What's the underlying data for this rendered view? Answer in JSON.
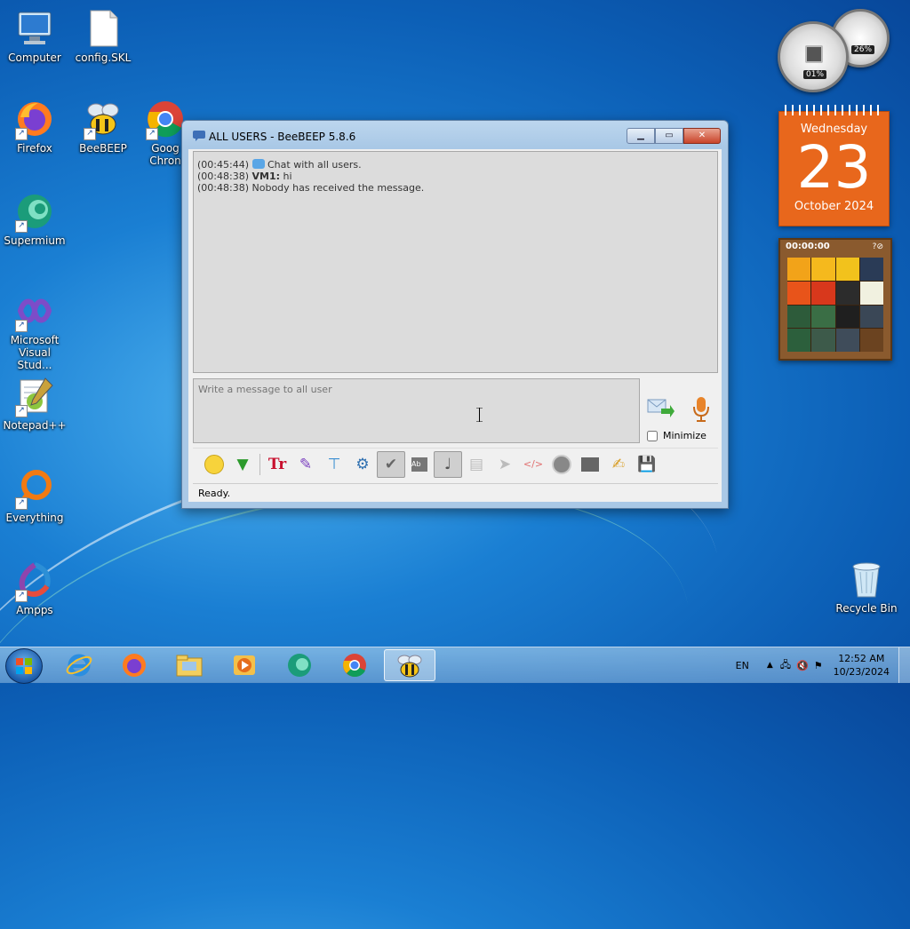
{
  "desktop": {
    "icons": [
      {
        "label": "Computer",
        "icon": "computer-icon"
      },
      {
        "label": "config.SKL",
        "icon": "file-icon"
      },
      {
        "label": "Firefox",
        "icon": "firefox-icon"
      },
      {
        "label": "BeeBEEP",
        "icon": "bee-icon"
      },
      {
        "label": "Goog Chron",
        "icon": "chrome-icon"
      },
      {
        "label": "Supermium",
        "icon": "supermium-icon"
      },
      {
        "label": "Microsoft Visual Stud...",
        "icon": "visual-studio-icon"
      },
      {
        "label": "Notepad++",
        "icon": "notepadpp-icon"
      },
      {
        "label": "Everything",
        "icon": "everything-icon"
      },
      {
        "label": "Ampps",
        "icon": "ampps-icon"
      },
      {
        "label": "Recycle Bin",
        "icon": "recycle-bin-icon"
      }
    ]
  },
  "gadgets": {
    "cpu": {
      "cpu_percent": "01%",
      "mem_percent": "26%"
    },
    "calendar": {
      "weekday": "Wednesday",
      "day": "23",
      "month_year": "October 2024"
    },
    "puzzle": {
      "timer": "00:00:00"
    }
  },
  "window": {
    "title": "ALL USERS - BeeBEEP 5.8.6",
    "chat": [
      {
        "time": "(00:45:44)",
        "user": "",
        "text": "Chat with all users."
      },
      {
        "time": "(00:48:38)",
        "user": "VM1:",
        "text": "hi"
      },
      {
        "time": "(00:48:38)",
        "user": "",
        "text": "Nobody has received the message."
      }
    ],
    "compose_placeholder": "Write a message to all user",
    "minimize_label": "Minimize",
    "status": "Ready."
  },
  "taskbar": {
    "language": "EN",
    "time": "12:52 AM",
    "date": "10/23/2024"
  },
  "colors": {
    "calendar_bg": "#e8671c",
    "desktop_blue": "#1a7fd3"
  }
}
